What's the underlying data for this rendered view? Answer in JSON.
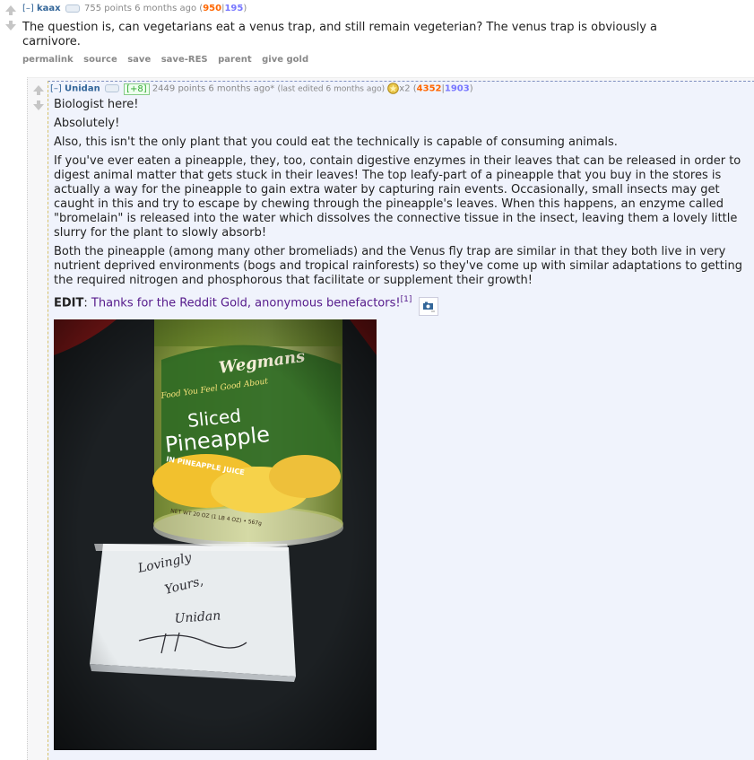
{
  "parent": {
    "toggle": "[–]",
    "author": "kaax",
    "score": "755 points 6 months ago",
    "up": "950",
    "sep": "|",
    "down": "195",
    "body": "The question is, can vegetarians eat a venus trap, and still remain vegeterian? The venus trap is obviously a carnivore.",
    "buttons": [
      "permalink",
      "source",
      "save",
      "save-RES",
      "parent",
      "give gold"
    ]
  },
  "child": {
    "toggle": "[–]",
    "author": "Unidan",
    "flair": "[+8]",
    "score": "2449 points 6 months ago*",
    "edited": "(last edited 6 months ago)",
    "gilded": "x2",
    "paren_open": "(",
    "up": "4352",
    "sep": "|",
    "down": "1903",
    "paren_close": ")",
    "p1": "Biologist here!",
    "p2": "Absolutely!",
    "p3": "Also, this isn't the only plant that you could eat the technically is capable of consuming animals.",
    "p4": "If you've ever eaten a pineapple, they, too, contain digestive enzymes in their leaves that can be released in order to digest animal matter that gets stuck in their leaves! The top leafy-part of a pineapple that you buy in the stores is actually a way for the pineapple to gain extra water by capturing rain events. Occasionally, small insects may get caught in this and try to escape by chewing through the pineapple's leaves. When this happens, an enzyme called \"bromelain\" is released into the water which dissolves the connective tissue in the insect, leaving them a lovely little slurry for the plant to slowly absorb!",
    "p5": "Both the pineapple (among many other bromeliads) and the Venus fly trap are similar in that they both live in very nutrient deprived environments (bogs and tropical rainforests) so they've come up with similar adaptations to getting the required nitrogen and phosphorous that facilitate or supplement their growth!",
    "edit_label": "EDIT",
    "edit_colon": ":",
    "edit_text": "Thanks for the Reddit Gold, anonymous benefactors!",
    "footnote": "[1]"
  },
  "photo": {
    "brand": "Wegmans",
    "tagline": "Food You Feel Good About",
    "product_line1": "Sliced",
    "product_line2": "Pineapple",
    "juice": "IN PINEAPPLE JUICE",
    "net_wt": "NET WT 20 OZ (1 LB 4 OZ) • 567g",
    "note_line1": "Lovingly",
    "note_line2": "Yours,",
    "note_line3": "Unidan"
  },
  "colors": {
    "author_blue": "#336699",
    "upvote_orange": "#ff6600",
    "downvote_blue": "#7777ff",
    "child_bg": "#f0f3fc"
  }
}
